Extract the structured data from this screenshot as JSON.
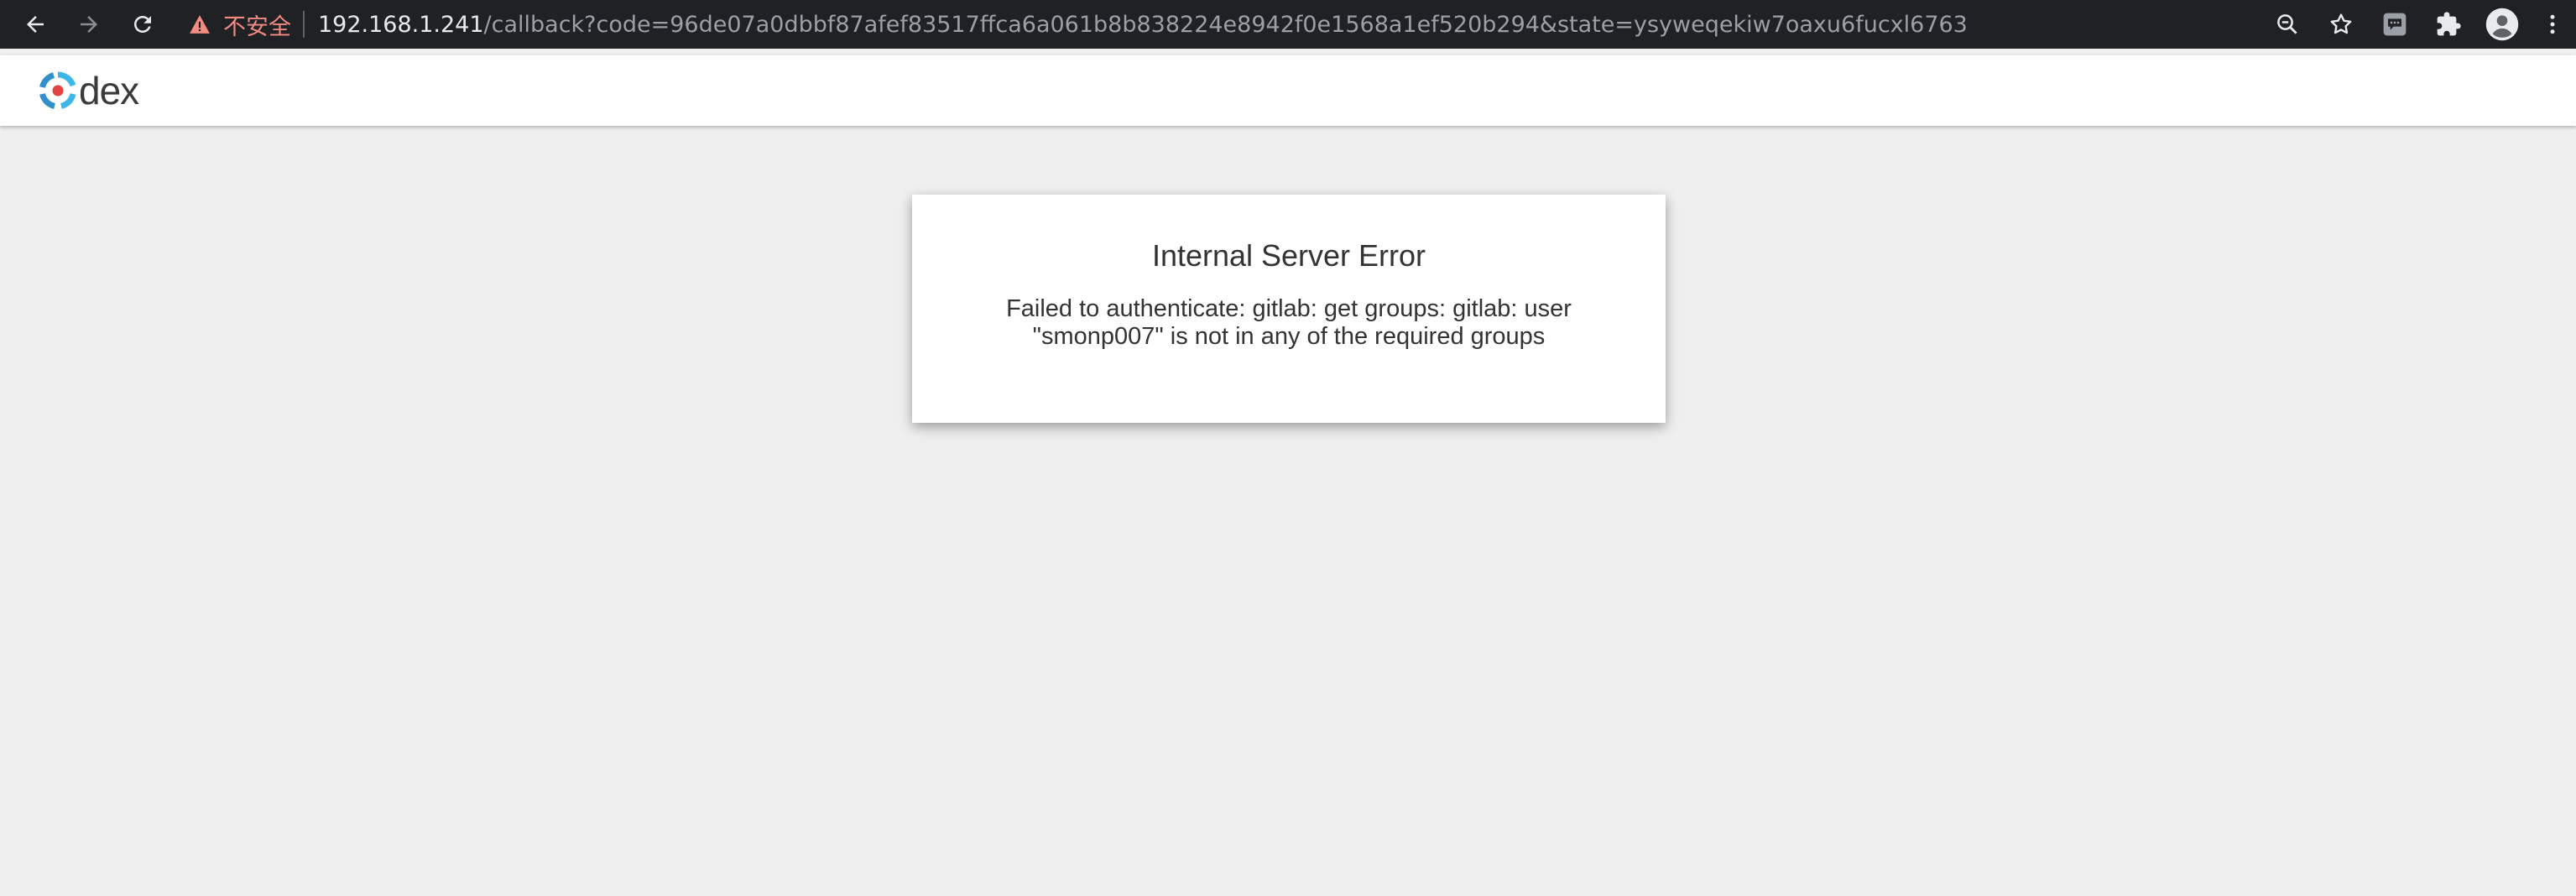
{
  "browser": {
    "back_icon": "arrow-left-icon",
    "forward_icon": "arrow-right-icon",
    "reload_icon": "reload-icon",
    "security_label": "不安全",
    "url_host": "192.168.1.241",
    "url_path": "/callback?code=96de07a0dbbf87afef83517ffca6a061b8b838224e8942f0e1568a1ef520b294&state=ysyweqekiw7oaxu6fucxl6763",
    "warning_color": "#f28b82"
  },
  "header": {
    "logo_text": "dex"
  },
  "error": {
    "title": "Internal Server Error",
    "message": "Failed to authenticate: gitlab: get groups: gitlab: user \"smonp007\" is not in any of the required groups"
  }
}
